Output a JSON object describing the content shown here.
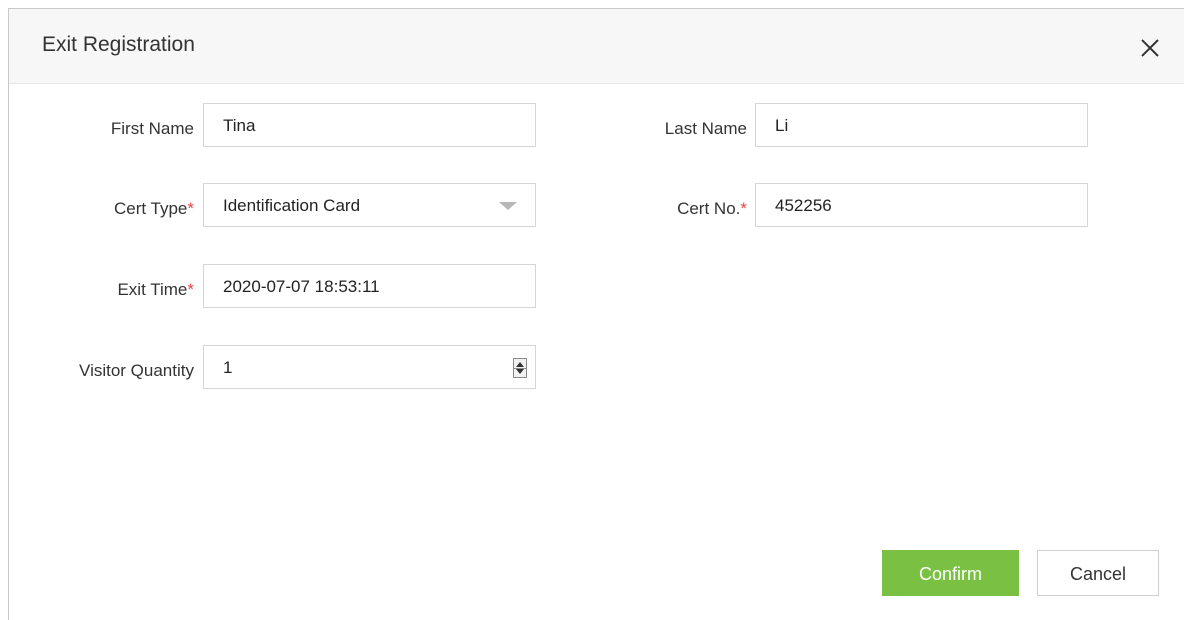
{
  "dialog": {
    "title": "Exit Registration",
    "close_icon": "close-icon"
  },
  "form": {
    "first_name": {
      "label": "First Name",
      "value": "Tina",
      "required": false
    },
    "last_name": {
      "label": "Last Name",
      "value": "Li",
      "required": false
    },
    "cert_type": {
      "label": "Cert Type",
      "required_mark": "*",
      "value": "Identification Card",
      "icon": "chevron-down-icon"
    },
    "cert_no": {
      "label": "Cert No.",
      "required_mark": "*",
      "value": "452256"
    },
    "exit_time": {
      "label": "Exit Time",
      "required_mark": "*",
      "value": "2020-07-07 18:53:11"
    },
    "visitor_quantity": {
      "label": "Visitor Quantity",
      "value": "1",
      "icon": "stepper-icon"
    }
  },
  "buttons": {
    "confirm_label": "Confirm",
    "cancel_label": "Cancel"
  },
  "colors": {
    "accent": "#7ac143",
    "required": "#e44545",
    "titlebar_bg": "#f7f7f7"
  }
}
